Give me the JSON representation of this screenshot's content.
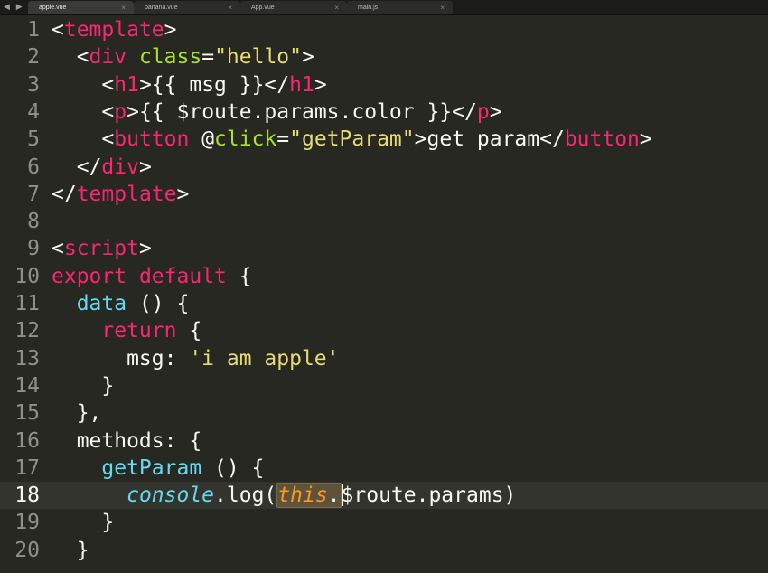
{
  "tabs": [
    {
      "label": "apple.vue",
      "active": true
    },
    {
      "label": "banana.vue",
      "active": false
    },
    {
      "label": "App.vue",
      "active": false
    },
    {
      "label": "main.js",
      "active": false
    }
  ],
  "tab_close_glyph": "×",
  "nav_arrows": "◀ ▶",
  "line_numbers": [
    "1",
    "2",
    "3",
    "4",
    "5",
    "6",
    "7",
    "8",
    "9",
    "10",
    "11",
    "12",
    "13",
    "14",
    "15",
    "16",
    "17",
    "18",
    "19",
    "20"
  ],
  "current_line": 18,
  "code": {
    "l1": [
      "<",
      "template",
      ">"
    ],
    "l2": [
      "  <",
      "div",
      " ",
      "class",
      "=",
      "\"hello\"",
      ">"
    ],
    "l3": [
      "    <",
      "h1",
      ">{{ msg }}</",
      "h1",
      ">"
    ],
    "l4": [
      "    <",
      "p",
      ">{{ $route.params.color }}</",
      "p",
      ">"
    ],
    "l5": [
      "    <",
      "button",
      " @",
      "click",
      "=",
      "\"getParam\"",
      ">get param</",
      "button",
      ">"
    ],
    "l6": [
      "  </",
      "div",
      ">"
    ],
    "l7": [
      "</",
      "template",
      ">"
    ],
    "l8": [
      ""
    ],
    "l9": [
      "<",
      "script",
      ">"
    ],
    "l10": [
      "export",
      " ",
      "default",
      " {"
    ],
    "l11": [
      "  ",
      "data",
      " () {"
    ],
    "l12": [
      "    ",
      "return",
      " {"
    ],
    "l13": [
      "      msg: ",
      "'i am apple'"
    ],
    "l14": [
      "    }"
    ],
    "l15": [
      "  },"
    ],
    "l16": [
      "  methods: {"
    ],
    "l17": [
      "    ",
      "getParam",
      " () {"
    ],
    "l18": [
      "      ",
      "console",
      ".log(",
      "this",
      ".",
      "$route.params)"
    ],
    "l19": [
      "    }"
    ],
    "l20": [
      "  }"
    ]
  }
}
